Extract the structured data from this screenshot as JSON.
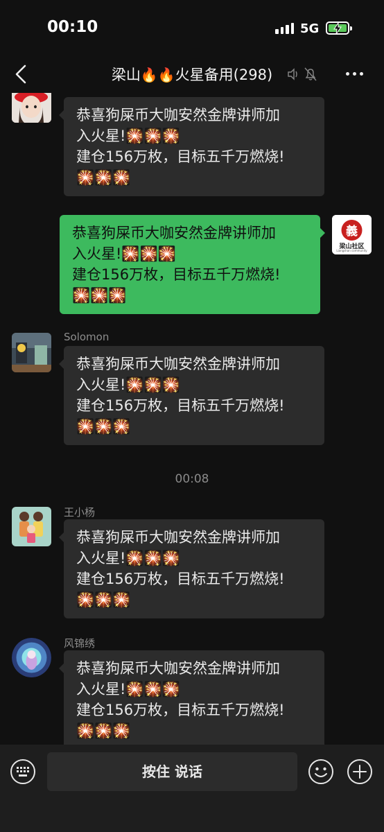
{
  "status_bar": {
    "time": "00:10",
    "network": "5G"
  },
  "header": {
    "title_part1": "梁山",
    "title_part2": "火星备用",
    "member_count": "(298)",
    "fire_emoji": "🔥"
  },
  "messages": [
    {
      "sender": "",
      "text": "恭喜狗屎币大咖安然金牌讲师加\n入火星!🎇🎇🎇\n建仓156万枚，目标五千万燃烧!\n🎇🎇🎇"
    },
    {
      "sender": "",
      "text": "恭喜狗屎币大咖安然金牌讲师加\n入火星!🎇🎇🎇\n建仓156万枚，目标五千万燃烧!\n🎇🎇🎇"
    },
    {
      "sender": "Solomon",
      "text": "恭喜狗屎币大咖安然金牌讲师加\n入火星!🎇🎇🎇\n建仓156万枚，目标五千万燃烧!\n🎇🎇🎇"
    },
    {
      "sender": "王小杨",
      "text": "恭喜狗屎币大咖安然金牌讲师加\n入火星!🎇🎇🎇\n建仓156万枚，目标五千万燃烧!\n🎇🎇🎇"
    },
    {
      "sender": "风锦绣",
      "text": "恭喜狗屎币大咖安然金牌讲师加\n入火星!🎇🎇🎇\n建仓156万枚，目标五千万燃烧!\n🎇🎇🎇"
    }
  ],
  "self_avatar": {
    "logo_char": "義",
    "logo_text": "梁山社区",
    "logo_subtext": "Liangshan community"
  },
  "timestamp": "00:08",
  "input_bar": {
    "voice_label": "按住 说话"
  },
  "colors": {
    "outgoing_bubble": "#3dba5e",
    "incoming_bubble": "#2c2c2c",
    "background": "#111111"
  },
  "icons": [
    "back-icon",
    "mute-icon",
    "more-icon",
    "keyboard-icon",
    "emoji-icon",
    "plus-icon"
  ]
}
